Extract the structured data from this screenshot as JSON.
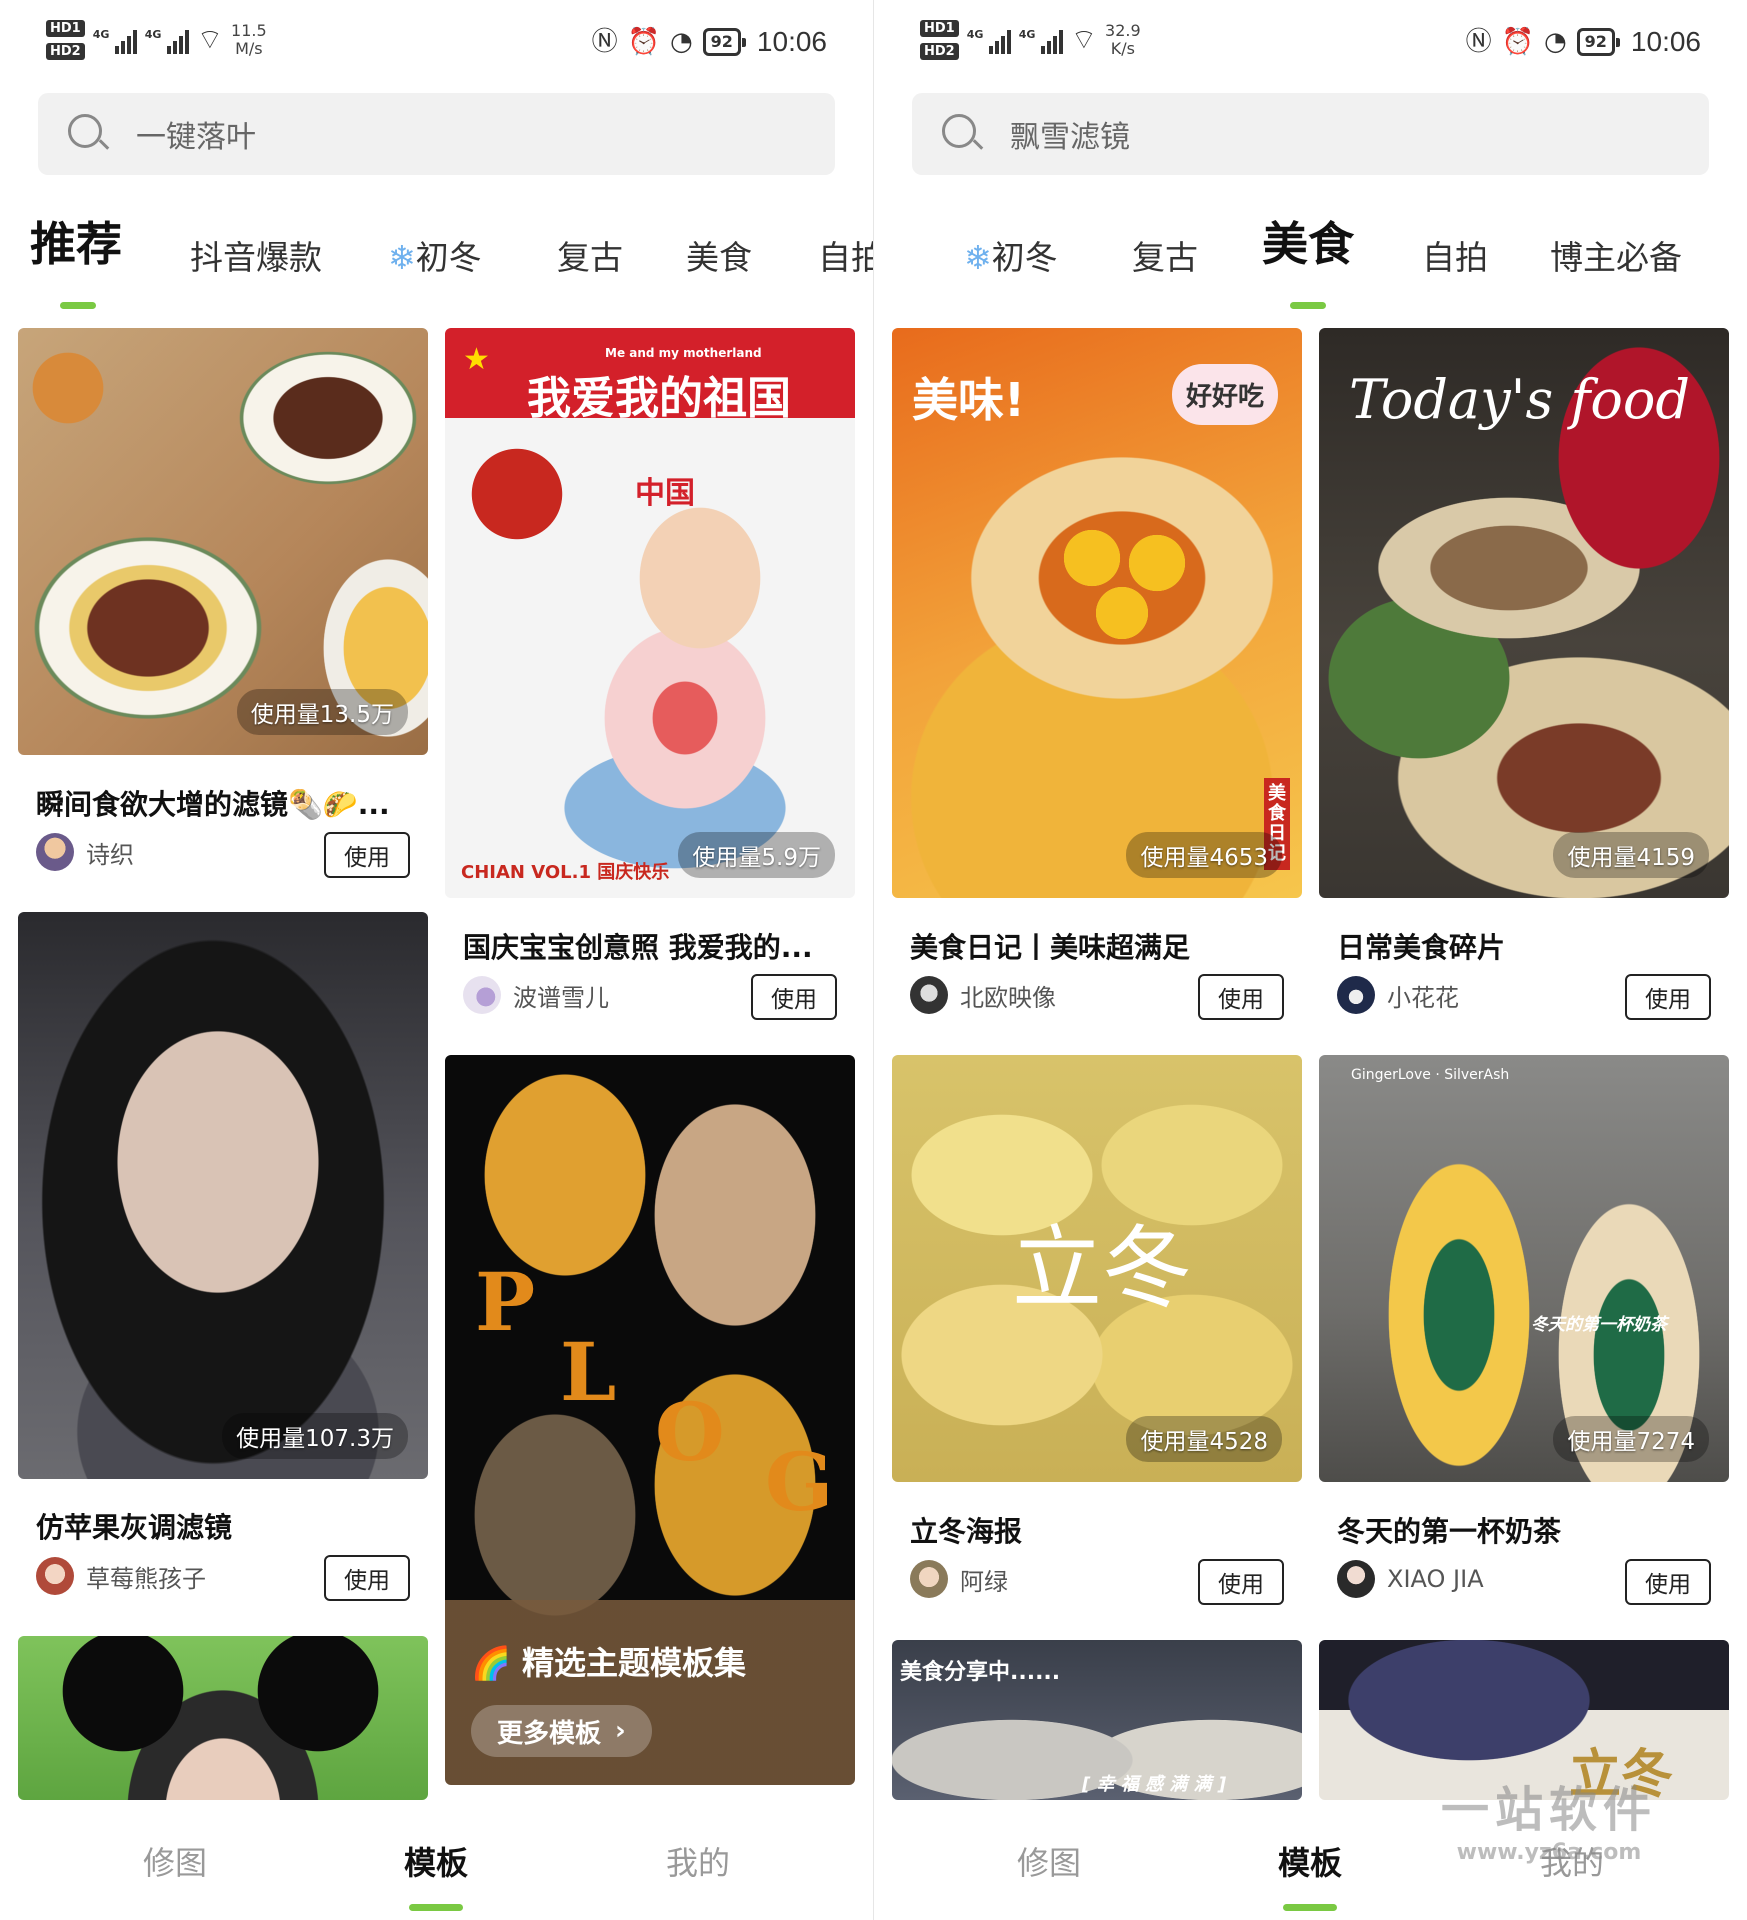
{
  "left": {
    "status": {
      "speed": "11.5\nM/s",
      "speed_value": "11.5",
      "speed_unit": "M/s",
      "battery": "92",
      "time": "10:06"
    },
    "search": {
      "placeholder": "一键落叶"
    },
    "tabs": [
      "推荐",
      "抖音爆款",
      "初冬",
      "复古",
      "美食",
      "自拍款"
    ],
    "active_tab": "推荐",
    "cards": [
      {
        "usage": "使用量13.5万",
        "title": "瞬间食欲大增的滤镜🌯🌮...",
        "author": "诗织",
        "button": "使用"
      },
      {
        "usage": "使用量5.9万",
        "title": "国庆宝宝创意照 我爱我的...",
        "author": "波谱雪儿",
        "button": "使用",
        "overlay_top": "我爱我的祖国",
        "overlay_sub": "Me and my motherland",
        "overlay_badge": "中国",
        "overlay_bottom": "CHIAN VOL.1 国庆快乐"
      },
      {
        "usage": "使用量107.3万",
        "title": "仿苹果灰调滤镜",
        "author": "草莓熊孩子",
        "button": "使用"
      }
    ],
    "promo": {
      "title": "精选主题模板集",
      "button": "更多模板",
      "letters": [
        "P",
        "L",
        "O",
        "G"
      ]
    },
    "nav": [
      "修图",
      "模板",
      "我的"
    ],
    "active_nav": "模板"
  },
  "right": {
    "status": {
      "speed_value": "32.9",
      "speed_unit": "K/s",
      "battery": "92",
      "time": "10:06"
    },
    "search": {
      "placeholder": "飘雪滤镜"
    },
    "tabs": [
      "初冬",
      "复古",
      "美食",
      "自拍",
      "博主必备"
    ],
    "active_tab": "美食",
    "cards": [
      {
        "usage": "使用量4653",
        "title": "美食日记丨美味超满足",
        "author": "北欧映像",
        "button": "使用",
        "overlay_a": "美味!",
        "overlay_b": "好好吃",
        "overlay_c": "美食日记"
      },
      {
        "usage": "使用量4159",
        "title": "日常美食碎片",
        "author": "小花花",
        "button": "使用",
        "overlay_a": "Today's food"
      },
      {
        "usage": "使用量4528",
        "title": "立冬海报",
        "author": "阿绿",
        "button": "使用",
        "overlay_a": "立冬"
      },
      {
        "usage": "使用量7274",
        "title": "冬天的第一杯奶茶",
        "author": "XIAO JIA",
        "button": "使用",
        "overlay_a": "冬天的第一杯奶茶",
        "overlay_b": "GingerLove · SilverAsh"
      },
      {
        "overlay_a": "美食分享中......",
        "overlay_b": "[ 幸 福 感 满 满 ]"
      },
      {
        "overlay_a": "立冬"
      }
    ],
    "nav": [
      "修图",
      "模板",
      "我的"
    ],
    "active_nav": "模板"
  },
  "watermark": {
    "main": "一站软件",
    "sub": "www.yz6a.com"
  },
  "colors": {
    "accent_green": "#7ac943",
    "search_bg": "#f1f1f1",
    "snow_blue": "#6fb1ee"
  },
  "icons": [
    "search-icon",
    "wifi-icon",
    "nfc-icon",
    "alarm-icon",
    "speed-icon",
    "battery-icon",
    "snowflake-icon",
    "chevron-right-icon",
    "rainbow-icon"
  ]
}
